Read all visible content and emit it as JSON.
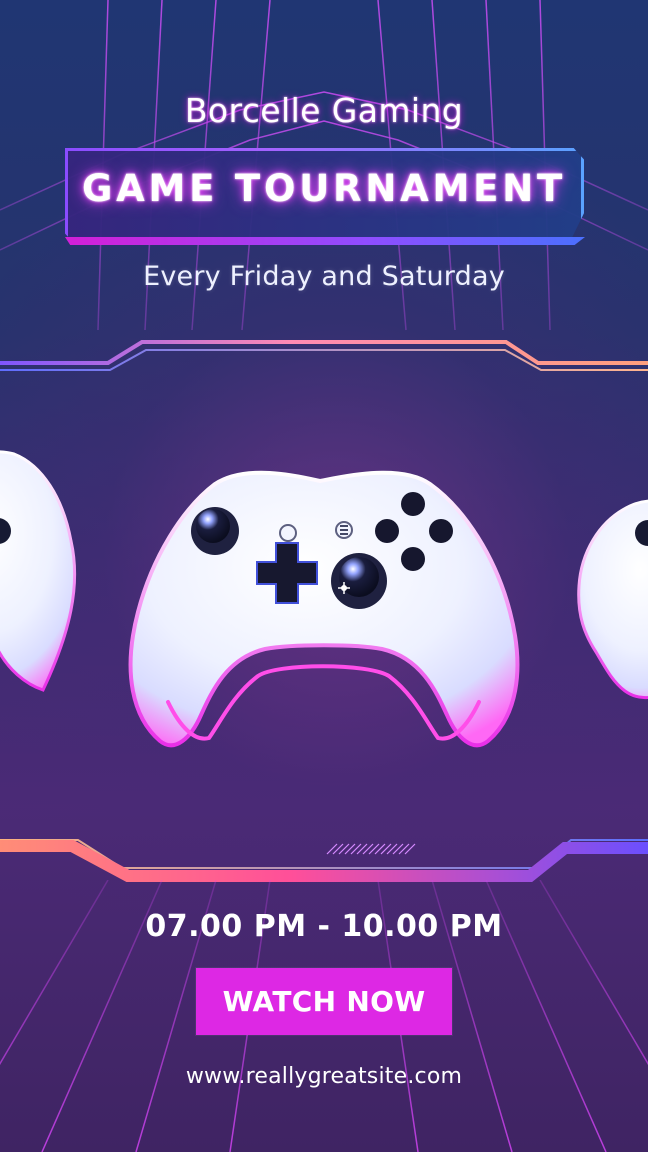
{
  "poster": {
    "brand": "Borcelle Gaming",
    "title": "GAME TOURNAMENT",
    "subtitle": "Every Friday and Saturday",
    "time": "07.00 PM - 10.00 PM",
    "cta_label": "WATCH NOW",
    "website": "www.reallygreatsite.com"
  },
  "visuals": {
    "grid_icon": "grid-pattern-icon",
    "controller_icon": "game-controller-icon",
    "background_colors": [
      "#203673",
      "#27336d",
      "#3c2c72",
      "#4b2a76",
      "#3f2463"
    ],
    "accent_colors": [
      "#dd28e4",
      "#8a4cff",
      "#4b70ff",
      "#ff7f73"
    ]
  }
}
